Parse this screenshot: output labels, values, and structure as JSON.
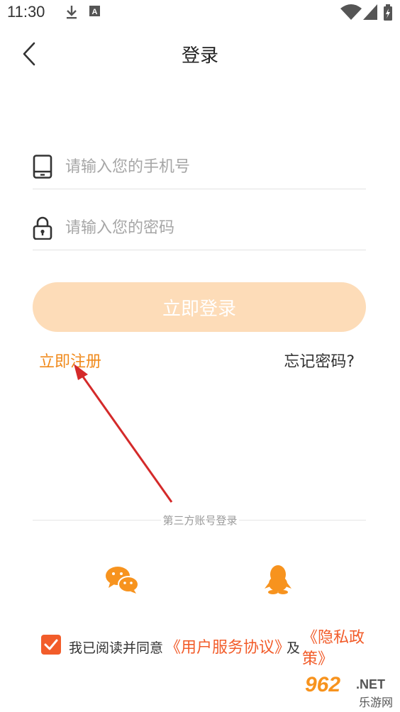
{
  "status_bar": {
    "time": "11:30",
    "icons": [
      "download-icon",
      "keyboard-a-icon",
      "wifi-icon",
      "signal-icon",
      "battery-icon"
    ]
  },
  "header": {
    "title": "登录",
    "back_icon": "back-arrow-icon"
  },
  "form": {
    "phone_placeholder": "请输入您的手机号",
    "password_placeholder": "请输入您的密码",
    "login_button": "立即登录"
  },
  "links": {
    "register": "立即注册",
    "forgot_password": "忘记密码?"
  },
  "third_party": {
    "label": "第三方账号登录",
    "options": [
      "wechat-icon",
      "qq-icon"
    ]
  },
  "agreement": {
    "checked": true,
    "prefix": "我已阅读并同意",
    "user_agreement": "《用户服务协议》",
    "and": "及",
    "privacy_line1": "《隐私政",
    "privacy_line2": "策》"
  },
  "watermark": {
    "text_top": "962",
    "text_net": ".NET",
    "text_bottom": "乐游网"
  },
  "colors": {
    "accent": "#f08a1c",
    "button_disabled": "#fddcb8",
    "link_red": "#f25c2a",
    "annotation_arrow": "#d42a2a"
  }
}
